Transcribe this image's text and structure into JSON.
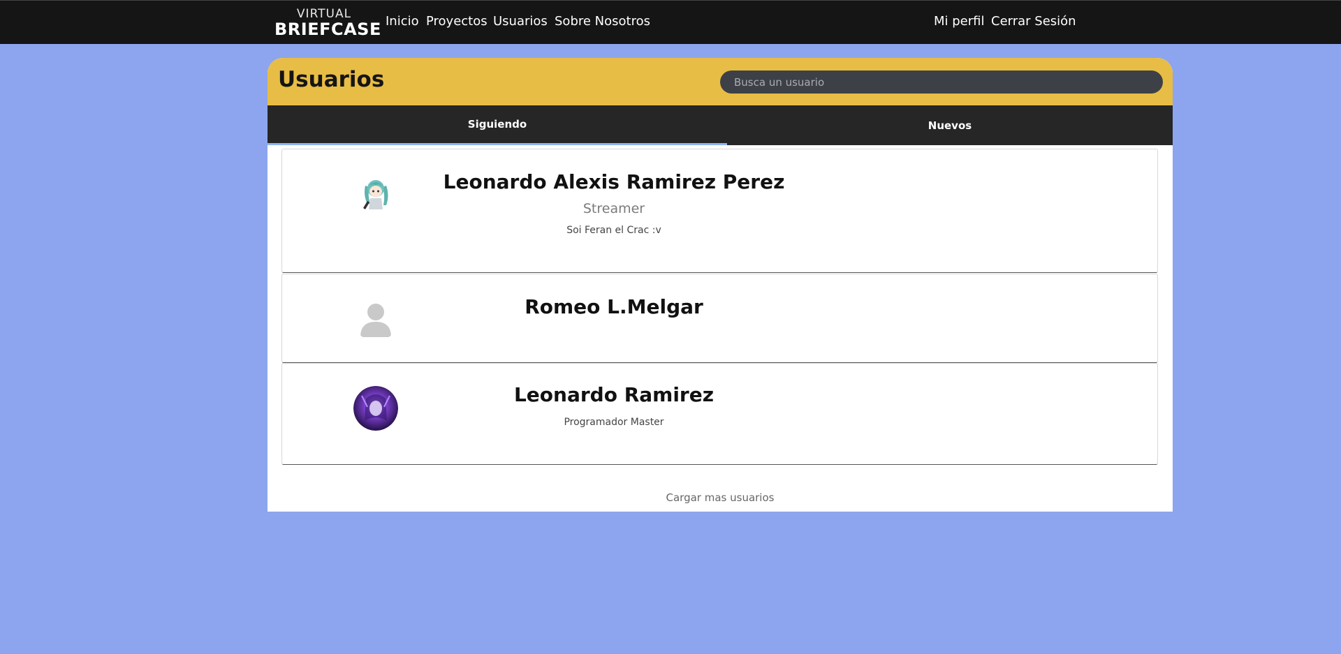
{
  "brand": {
    "top": "VIRTUAL",
    "bottom": "BRIEFCASE"
  },
  "nav": {
    "inicio": "Inicio",
    "proyectos": "Proyectos",
    "usuarios": "Usuarios",
    "sobre": "Sobre Nosotros",
    "perfil": "Mi perfil",
    "cerrar": "Cerrar Sesión"
  },
  "page": {
    "title": "Usuarios",
    "search_placeholder": "Busca un usuario"
  },
  "tabs": {
    "following": "Siguiendo",
    "new": "Nuevos",
    "active": "following"
  },
  "users": [
    {
      "name": "Leonardo Alexis Ramirez Perez",
      "role": "Streamer",
      "bio": "Soi Feran el Crac :v"
    },
    {
      "name": "Romeo L.Melgar"
    },
    {
      "name": "Leonardo Ramirez",
      "bio": "Programador Master"
    }
  ],
  "load_more": "Cargar mas usuarios",
  "colors": {
    "background": "#8da5ee",
    "header": "#e8bd45",
    "navbar": "#151515",
    "tab_bar": "#262626",
    "tab_indicator": "#8fb4f2"
  }
}
